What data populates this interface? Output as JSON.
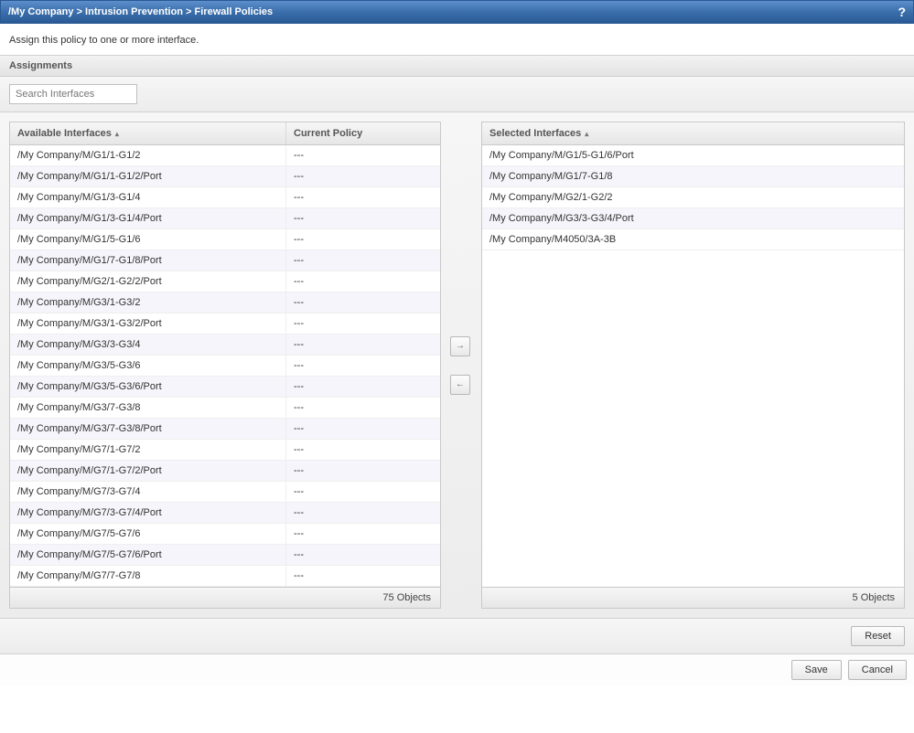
{
  "breadcrumb": "/My Company > Intrusion Prevention > Firewall Policies",
  "help_symbol": "?",
  "instruction": "Assign this policy to one or more interface.",
  "section_title": "Assignments",
  "search_placeholder": "Search Interfaces",
  "headers": {
    "available": "Available Interfaces",
    "current_policy": "Current Policy",
    "selected": "Selected Interfaces"
  },
  "available": [
    {
      "name": "/My Company/M/G1/1-G1/2",
      "policy": "---"
    },
    {
      "name": "/My Company/M/G1/1-G1/2/Port",
      "policy": "---"
    },
    {
      "name": "/My Company/M/G1/3-G1/4",
      "policy": "---"
    },
    {
      "name": "/My Company/M/G1/3-G1/4/Port",
      "policy": "---"
    },
    {
      "name": "/My Company/M/G1/5-G1/6",
      "policy": "---"
    },
    {
      "name": "/My Company/M/G1/7-G1/8/Port",
      "policy": "---"
    },
    {
      "name": "/My Company/M/G2/1-G2/2/Port",
      "policy": "---"
    },
    {
      "name": "/My Company/M/G3/1-G3/2",
      "policy": "---"
    },
    {
      "name": "/My Company/M/G3/1-G3/2/Port",
      "policy": "---"
    },
    {
      "name": "/My Company/M/G3/3-G3/4",
      "policy": "---"
    },
    {
      "name": "/My Company/M/G3/5-G3/6",
      "policy": "---"
    },
    {
      "name": "/My Company/M/G3/5-G3/6/Port",
      "policy": "---"
    },
    {
      "name": "/My Company/M/G3/7-G3/8",
      "policy": "---"
    },
    {
      "name": "/My Company/M/G3/7-G3/8/Port",
      "policy": "---"
    },
    {
      "name": "/My Company/M/G7/1-G7/2",
      "policy": "---"
    },
    {
      "name": "/My Company/M/G7/1-G7/2/Port",
      "policy": "---"
    },
    {
      "name": "/My Company/M/G7/3-G7/4",
      "policy": "---"
    },
    {
      "name": "/My Company/M/G7/3-G7/4/Port",
      "policy": "---"
    },
    {
      "name": "/My Company/M/G7/5-G7/6",
      "policy": "---"
    },
    {
      "name": "/My Company/M/G7/5-G7/6/Port",
      "policy": "---"
    },
    {
      "name": "/My Company/M/G7/7-G7/8",
      "policy": "---"
    }
  ],
  "selected": [
    {
      "name": "/My Company/M/G1/5-G1/6/Port"
    },
    {
      "name": "/My Company/M/G1/7-G1/8"
    },
    {
      "name": "/My Company/M/G2/1-G2/2"
    },
    {
      "name": "/My Company/M/G3/3-G3/4/Port"
    },
    {
      "name": "/My Company/M4050/3A-3B"
    }
  ],
  "counts": {
    "available": "75 Objects",
    "selected": "5 Objects"
  },
  "buttons": {
    "reset": "Reset",
    "save": "Save",
    "cancel": "Cancel",
    "add": "→",
    "remove": "←"
  }
}
